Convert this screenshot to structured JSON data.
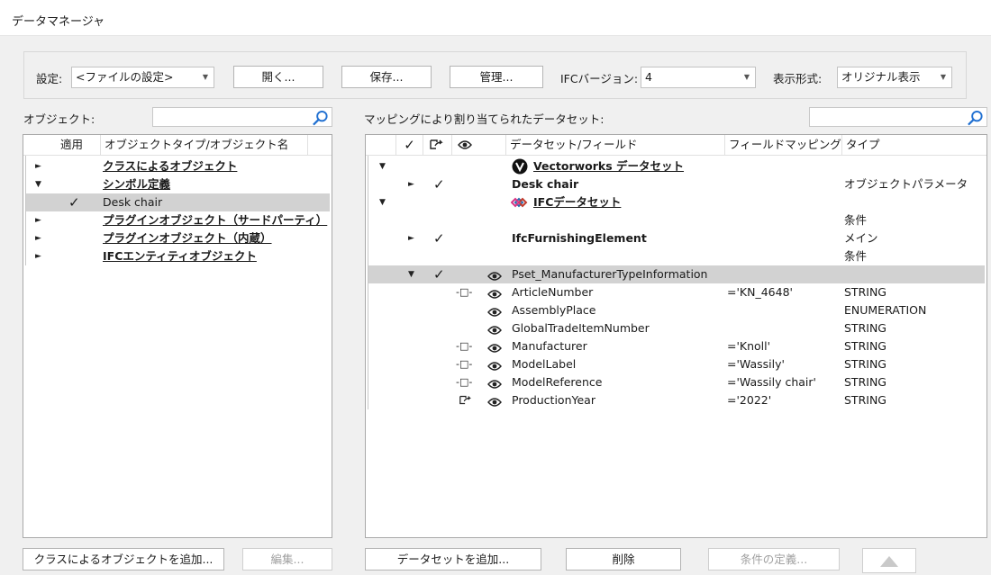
{
  "window": {
    "title": "データマネージャ"
  },
  "toolbar": {
    "settings_label": "設定:",
    "settings_value": "<ファイルの設定>",
    "open_label": "開く...",
    "save_label": "保存...",
    "manage_label": "管理...",
    "ifc_version_label": "IFCバージョン:",
    "ifc_version_value": "4",
    "display_format_label": "表示形式:",
    "display_format_value": "オリジナル表示"
  },
  "objects": {
    "label": "オブジェクト:",
    "search_placeholder": "",
    "headers": {
      "apply": "適用",
      "name": "オブジェクトタイプ/オブジェクト名"
    },
    "items": [
      {
        "expander": "►",
        "applied": "",
        "name": "クラスによるオブジェクト",
        "style": "u"
      },
      {
        "expander": "▼",
        "applied": "",
        "name": "シンボル定義",
        "style": "u"
      },
      {
        "expander": "",
        "applied": "✓",
        "name": "Desk chair",
        "style": "plain",
        "selected": true
      },
      {
        "expander": "►",
        "applied": "",
        "name": "プラグインオブジェクト（サードパーティ）",
        "style": "u"
      },
      {
        "expander": "►",
        "applied": "",
        "name": "プラグインオブジェクト（内蔵）",
        "style": "u"
      },
      {
        "expander": "►",
        "applied": "",
        "name": "IFCエンティティオブジェクト",
        "style": "u"
      }
    ],
    "add_class_label": "クラスによるオブジェクトを追加...",
    "edit_label": "編集..."
  },
  "datasets": {
    "label": "マッピングにより割り当てられたデータセット:",
    "search_placeholder": "",
    "headers": {
      "check": "✓",
      "name": "データセット/フィールド",
      "mapping": "フィールドマッピング",
      "type": "タイプ"
    },
    "rows": [
      {
        "exp1": "▼",
        "exp2": "",
        "check": "",
        "map_icon": "",
        "eye": "",
        "name": "Vectorworks データセット",
        "style": "u",
        "logo": "vectorworks-logo",
        "mapping": "",
        "type": ""
      },
      {
        "exp1": "",
        "exp2": "►",
        "check": "✓",
        "map_icon": "",
        "eye": "",
        "name": "Desk chair",
        "style": "b",
        "logo": "",
        "mapping": "",
        "type": "オブジェクトパラメータ"
      },
      {
        "exp1": "▼",
        "exp2": "",
        "check": "",
        "map_icon": "",
        "eye": "",
        "name": "IFCデータセット",
        "style": "u",
        "logo": "ifc-logo",
        "mapping": "",
        "type": ""
      },
      {
        "exp1": "",
        "exp2": "",
        "check": "",
        "map_icon": "",
        "eye": "",
        "name": "",
        "style": "plain",
        "logo": "",
        "mapping": "",
        "type": "条件"
      },
      {
        "exp1": "",
        "exp2": "►",
        "check": "✓",
        "map_icon": "",
        "eye": "",
        "name": "IfcFurnishingElement",
        "style": "b",
        "logo": "",
        "mapping": "",
        "type": "メイン"
      },
      {
        "exp1": "",
        "exp2": "",
        "check": "",
        "map_icon": "",
        "eye": "",
        "name": "",
        "style": "plain",
        "logo": "",
        "mapping": "",
        "type": "条件"
      },
      {
        "exp1": "",
        "exp2": "▼",
        "check": "✓",
        "map_icon": "",
        "eye": "eye",
        "name": "Pset_ManufacturerTypeInformation",
        "style": "plain",
        "logo": "",
        "mapping": "",
        "type": "",
        "selected": true
      },
      {
        "exp1": "",
        "exp2": "",
        "check": "",
        "map_icon": "-□-",
        "eye": "eye",
        "name": "ArticleNumber",
        "style": "plain",
        "logo": "",
        "mapping": "='KN_4648'",
        "type": "STRING"
      },
      {
        "exp1": "",
        "exp2": "",
        "check": "",
        "map_icon": "",
        "eye": "eye",
        "name": "AssemblyPlace",
        "style": "plain",
        "logo": "",
        "mapping": "",
        "type": "ENUMERATION"
      },
      {
        "exp1": "",
        "exp2": "",
        "check": "",
        "map_icon": "",
        "eye": "eye",
        "name": "GlobalTradeItemNumber",
        "style": "plain",
        "logo": "",
        "mapping": "",
        "type": "STRING"
      },
      {
        "exp1": "",
        "exp2": "",
        "check": "",
        "map_icon": "-□-",
        "eye": "eye",
        "name": "Manufacturer",
        "style": "plain",
        "logo": "",
        "mapping": "='Knoll'",
        "type": "STRING"
      },
      {
        "exp1": "",
        "exp2": "",
        "check": "",
        "map_icon": "-□-",
        "eye": "eye",
        "name": "ModelLabel",
        "style": "plain",
        "logo": "",
        "mapping": "='Wassily'",
        "type": "STRING"
      },
      {
        "exp1": "",
        "exp2": "",
        "check": "",
        "map_icon": "-□-",
        "eye": "eye",
        "name": "ModelReference",
        "style": "plain",
        "logo": "",
        "mapping": "='Wassily chair'",
        "type": "STRING"
      },
      {
        "exp1": "",
        "exp2": "",
        "check": "",
        "map_icon": "share",
        "eye": "eye",
        "name": "ProductionYear",
        "style": "plain",
        "logo": "",
        "mapping": "='2022'",
        "type": "STRING"
      }
    ],
    "add_dataset_label": "データセットを追加...",
    "delete_label": "削除",
    "define_conditions_label": "条件の定義..."
  }
}
